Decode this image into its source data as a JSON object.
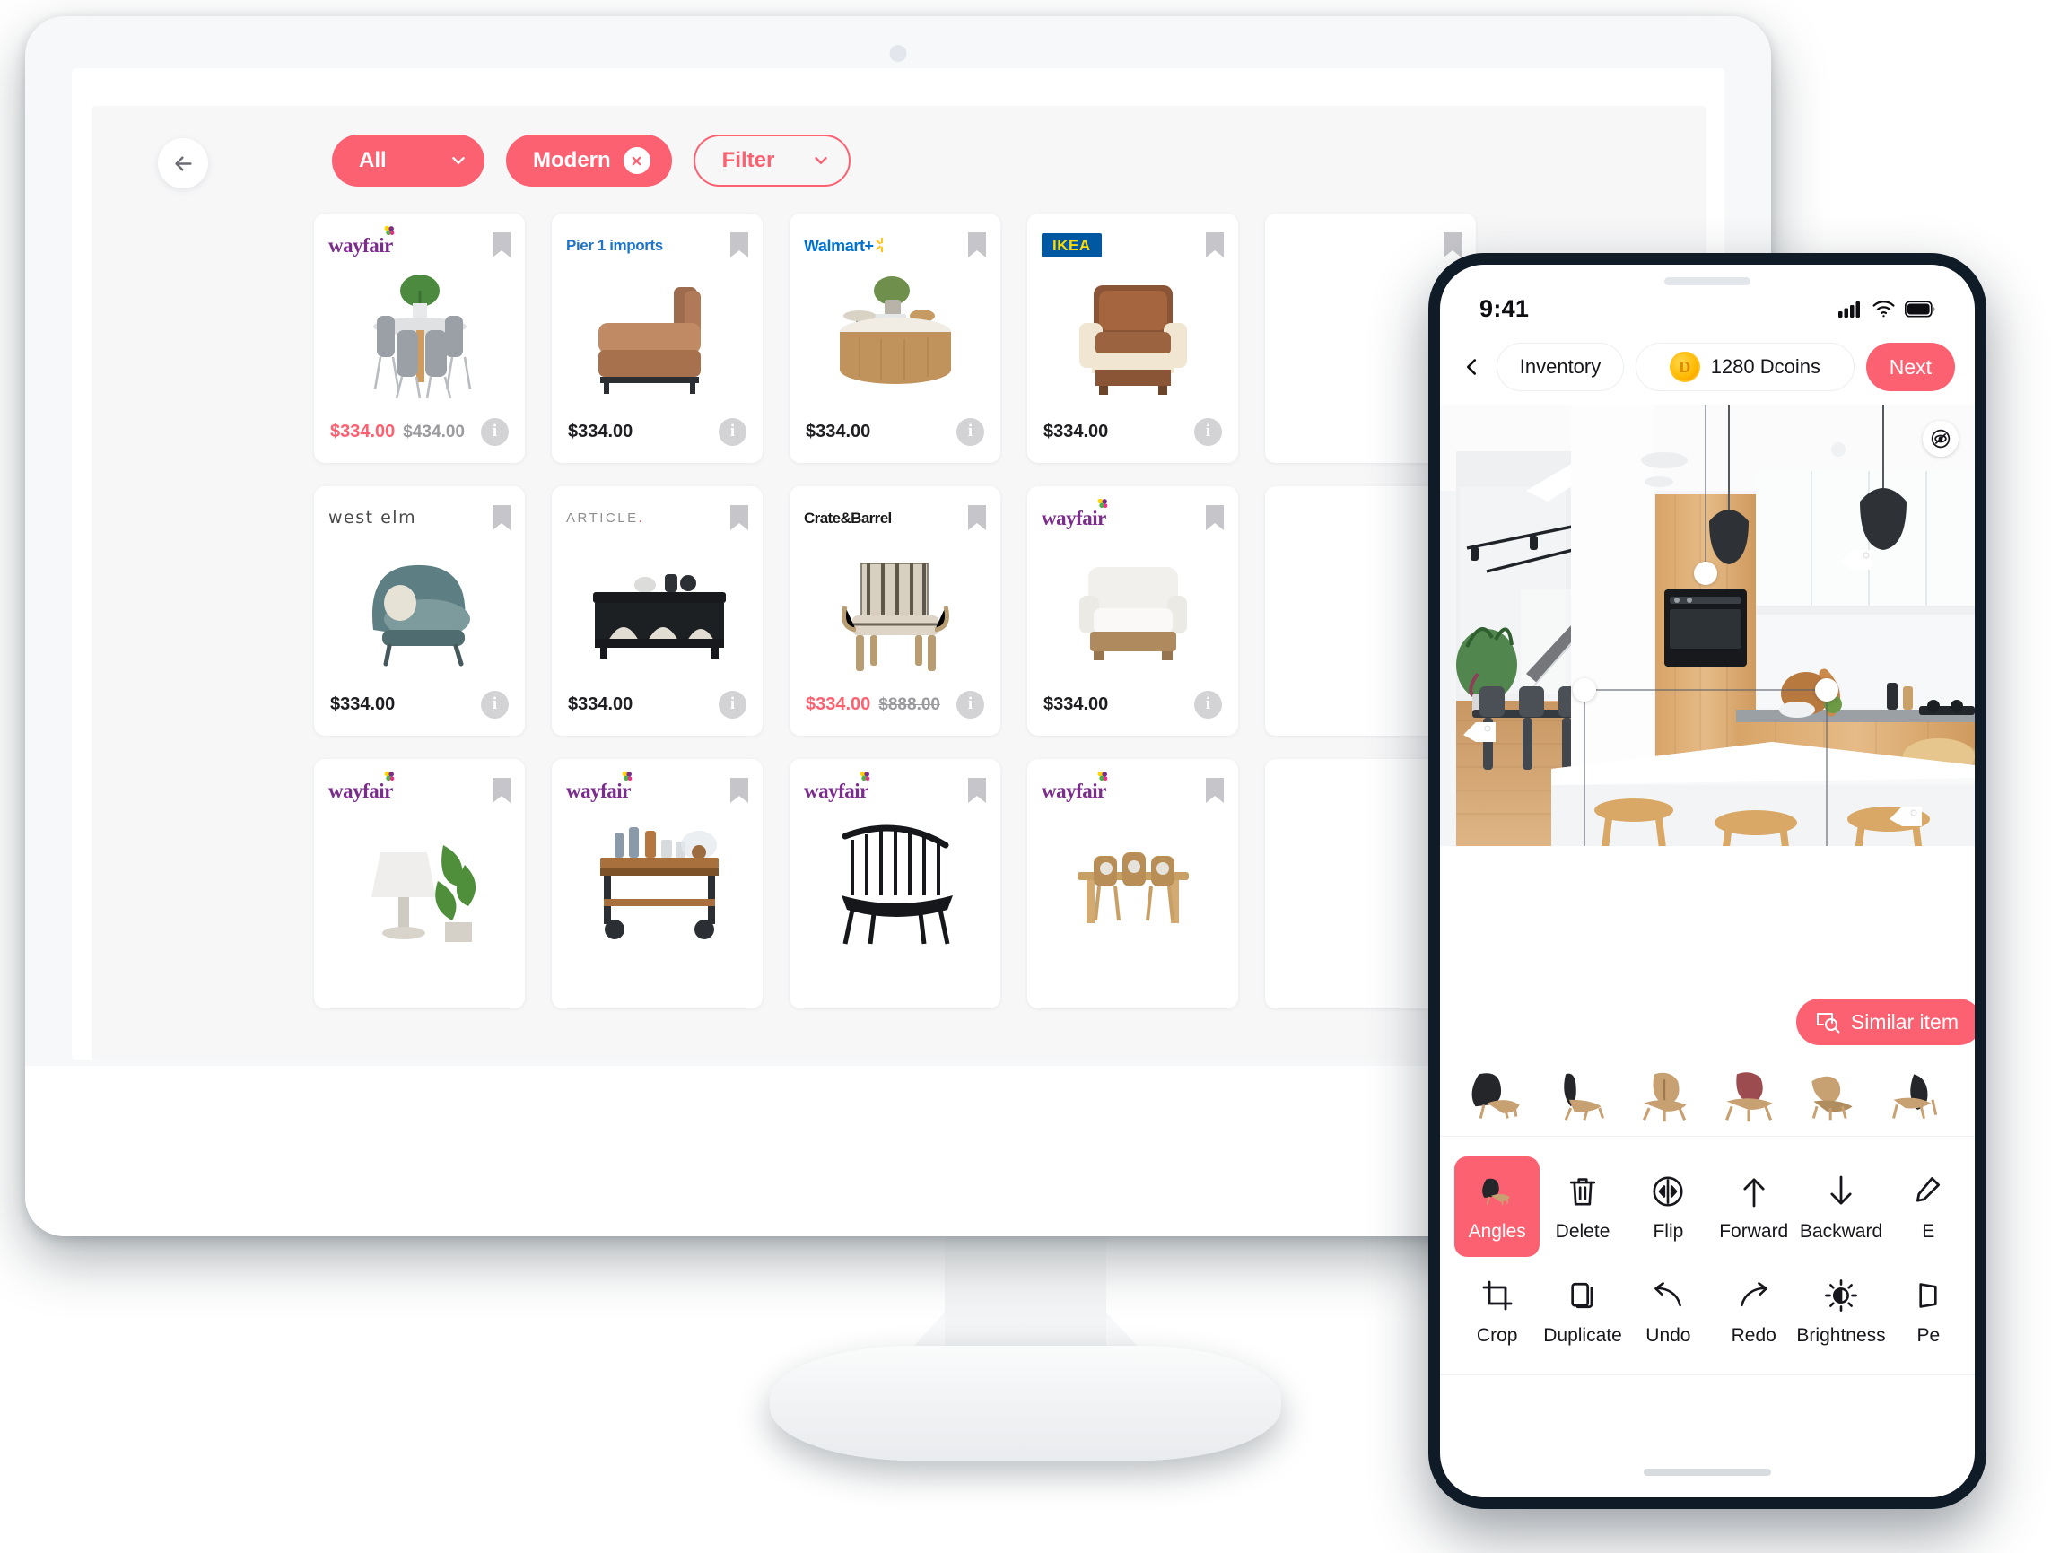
{
  "desktop": {
    "back_button_icon": "arrow-left-icon",
    "filters": [
      {
        "label": "All",
        "style": "solid",
        "icon": "chevron-down-icon",
        "removable": false
      },
      {
        "label": "Modern",
        "style": "solid",
        "icon": "close-icon",
        "removable": true
      },
      {
        "label": "Filter",
        "style": "outline",
        "icon": "chevron-down-icon",
        "removable": false
      }
    ],
    "products": [
      {
        "brand": "wayfair",
        "brand_style": "wayfair",
        "price": "$334.00",
        "old_price": "$434.00",
        "on_sale": true,
        "item": "round-dining-table-set",
        "bookmark_icon": "bookmark-icon",
        "info_icon": "info-icon"
      },
      {
        "brand": "Pier 1 imports",
        "brand_style": "pier1",
        "price": "$334.00",
        "old_price": "",
        "on_sale": false,
        "item": "leather-chaise-sofa",
        "bookmark_icon": "bookmark-icon",
        "info_icon": "info-icon"
      },
      {
        "brand": "Walmart",
        "brand_style": "walmart",
        "price": "$334.00",
        "old_price": "",
        "on_sale": false,
        "item": "round-wood-coffee-table",
        "bookmark_icon": "bookmark-icon",
        "info_icon": "info-icon"
      },
      {
        "brand": "IKEA",
        "brand_style": "ikea",
        "price": "$334.00",
        "old_price": "",
        "on_sale": false,
        "item": "brown-leather-armchair",
        "bookmark_icon": "bookmark-icon",
        "info_icon": "info-icon"
      },
      {
        "brand": "",
        "brand_style": "wayfair",
        "price": "",
        "old_price": "",
        "on_sale": false,
        "item": "hidden-card",
        "bookmark_icon": "bookmark-icon",
        "info_icon": "info-icon"
      },
      {
        "brand": "west elm",
        "brand_style": "westelm",
        "price": "$334.00",
        "old_price": "",
        "on_sale": false,
        "item": "teal-curved-armchair",
        "bookmark_icon": "bookmark-icon",
        "info_icon": "info-icon"
      },
      {
        "brand": "ARTICLE.",
        "brand_style": "article",
        "price": "$334.00",
        "old_price": "",
        "on_sale": false,
        "item": "black-console-sideboard",
        "bookmark_icon": "bookmark-icon",
        "info_icon": "info-icon"
      },
      {
        "brand": "Crate&Barrel",
        "brand_style": "crate",
        "price": "$334.00",
        "old_price": "$888.00",
        "on_sale": true,
        "item": "striped-spindle-chair",
        "bookmark_icon": "bookmark-icon",
        "info_icon": "info-icon"
      },
      {
        "brand": "wayfair",
        "brand_style": "wayfair",
        "price": "$334.00",
        "old_price": "",
        "on_sale": false,
        "item": "white-boucle-armchair",
        "bookmark_icon": "bookmark-icon",
        "info_icon": "info-icon"
      },
      {
        "brand": "",
        "brand_style": "wayfair",
        "price": "",
        "old_price": "",
        "on_sale": false,
        "item": "hidden-card",
        "bookmark_icon": "bookmark-icon",
        "info_icon": "info-icon"
      },
      {
        "brand": "wayfair",
        "brand_style": "wayfair",
        "price": "",
        "old_price": "",
        "on_sale": false,
        "item": "lamp-and-plant",
        "bookmark_icon": "bookmark-icon",
        "info_icon": "info-icon"
      },
      {
        "brand": "wayfair",
        "brand_style": "wayfair",
        "price": "",
        "old_price": "",
        "on_sale": false,
        "item": "bar-cart",
        "bookmark_icon": "bookmark-icon",
        "info_icon": "info-icon"
      },
      {
        "brand": "wayfair",
        "brand_style": "wayfair",
        "price": "",
        "old_price": "",
        "on_sale": false,
        "item": "windsor-black-chair",
        "bookmark_icon": "bookmark-icon",
        "info_icon": "info-icon"
      },
      {
        "brand": "wayfair",
        "brand_style": "wayfair",
        "price": "",
        "old_price": "",
        "on_sale": false,
        "item": "rattan-dining-set",
        "bookmark_icon": "bookmark-icon",
        "info_icon": "info-icon"
      },
      {
        "brand": "",
        "brand_style": "wayfair",
        "price": "",
        "old_price": "",
        "on_sale": false,
        "item": "hidden-card",
        "bookmark_icon": "bookmark-icon",
        "info_icon": "info-icon"
      }
    ]
  },
  "phone": {
    "status": {
      "time": "9:41",
      "signal_icon": "cellular-bars-icon",
      "wifi_icon": "wifi-icon",
      "battery_icon": "battery-icon"
    },
    "header": {
      "back_icon": "chevron-left-icon",
      "inventory_label": "Inventory",
      "coins_label": "1280 Dcoins",
      "coin_icon": "dcoin-icon",
      "next_label": "Next"
    },
    "canvas": {
      "visibility_icon": "eye-slash-icon",
      "close_selection_icon": "close-icon",
      "scene": "modern-kitchen-interior",
      "tag_pins": 4,
      "handles": 5
    },
    "similar_button": {
      "label": "Similar item",
      "icon": "image-search-icon"
    },
    "angle_thumbs": [
      "chair-angle-side-black",
      "chair-angle-rear-black",
      "chair-angle-front-wood",
      "chair-angle-front-red",
      "chair-angle-side-wood",
      "chair-angle-back-wood"
    ],
    "tools": [
      {
        "label": "Angles",
        "icon": "chair-icon",
        "active": true
      },
      {
        "label": "Delete",
        "icon": "trash-icon",
        "active": false
      },
      {
        "label": "Flip",
        "icon": "flip-icon",
        "active": false
      },
      {
        "label": "Forward",
        "icon": "arrow-up-icon",
        "active": false
      },
      {
        "label": "Backward",
        "icon": "arrow-down-icon",
        "active": false
      },
      {
        "label": "E",
        "icon": "edit-icon",
        "active": false
      },
      {
        "label": "Crop",
        "icon": "crop-icon",
        "active": false
      },
      {
        "label": "Duplicate",
        "icon": "duplicate-icon",
        "active": false
      },
      {
        "label": "Undo",
        "icon": "undo-arrow-icon",
        "active": false
      },
      {
        "label": "Redo",
        "icon": "redo-arrow-icon",
        "active": false
      },
      {
        "label": "Brightness",
        "icon": "brightness-icon",
        "active": false
      },
      {
        "label": "Pe",
        "icon": "perspective-icon",
        "active": false
      }
    ],
    "home_indicator": "home-indicator"
  },
  "colors": {
    "accent": "#fc6171",
    "wayfair_purple": "#7b2d8b",
    "pier1_blue": "#1f74c8",
    "walmart_blue": "#0071ce",
    "ikea_blue": "#0058a3",
    "ikea_yellow": "#ffdb00",
    "coin_gold": "#ffb800",
    "app_bg": "#f7f7f8"
  }
}
